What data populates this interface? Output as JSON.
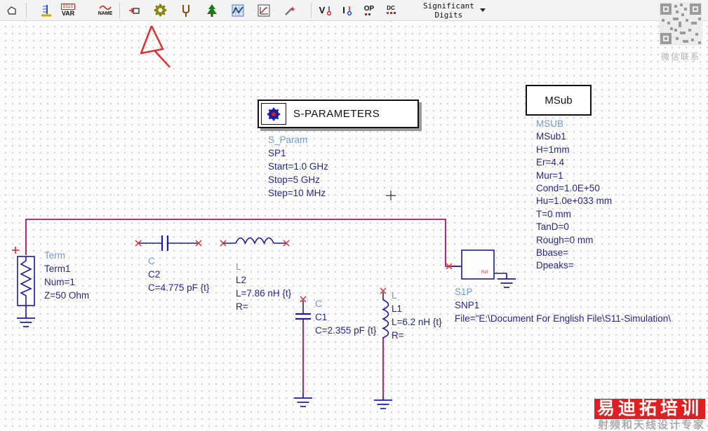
{
  "toolbar": {
    "var_top": "0110",
    "var_label": "VAR",
    "name_label": "NAME",
    "v_label": "V",
    "i_label": "I",
    "op_label": "OP",
    "dc_label": "DC",
    "significant_digits_line1": "Significant",
    "significant_digits_line2": "Digits"
  },
  "qr": {
    "caption": "微信联系"
  },
  "blocks": {
    "sparams": {
      "title": "S-PARAMETERS",
      "type": "S_Param",
      "lines": [
        "SP1",
        "Start=1.0 GHz",
        "Stop=5 GHz",
        "Step=10 MHz"
      ]
    },
    "msub": {
      "title": "MSub",
      "type": "MSUB",
      "lines": [
        "MSub1",
        "H=1mm",
        "Er=4.4",
        "Mur=1",
        "Cond=1.0E+50",
        "Hu=1.0e+033 mm",
        "T=0 mm",
        "TanD=0",
        "Rough=0 mm",
        "Bbase=",
        "Dpeaks="
      ]
    }
  },
  "components": {
    "term": {
      "type": "Term",
      "lines": [
        "Term1",
        "Num=1",
        "Z=50 Ohm"
      ]
    },
    "c2": {
      "type": "C",
      "lines": [
        "C2",
        "C=4.775 pF {t}"
      ]
    },
    "l2": {
      "type": "L",
      "lines": [
        "L2",
        "L=7.86 nH {t}",
        "R="
      ]
    },
    "c1": {
      "type": "C",
      "lines": [
        "C1",
        "C=2.355 pF {t}"
      ]
    },
    "l1": {
      "type": "L",
      "lines": [
        "L1",
        "L=6.2 nH {t}",
        "R="
      ]
    },
    "snp": {
      "type": "S1P",
      "ref": "Ref",
      "lines": [
        "SNP1",
        "File=\"E:\\Document For English File\\S11-Simulation\\"
      ]
    }
  },
  "watermark": {
    "title": "易迪拓培训",
    "subtitle": "射频和天线设计专家"
  }
}
